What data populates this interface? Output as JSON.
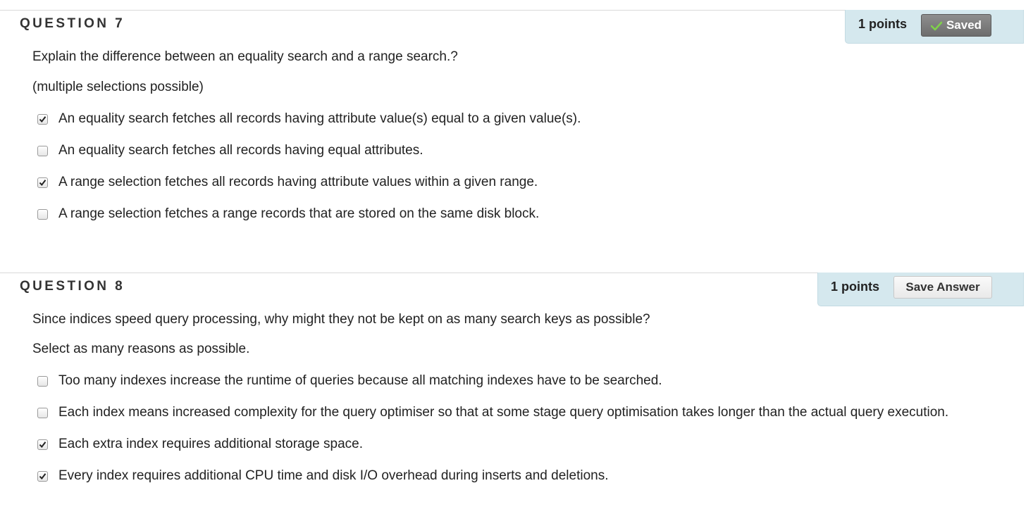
{
  "questions": [
    {
      "title": "QUESTION 7",
      "points": "1 points",
      "button_label": "Saved",
      "button_state": "saved",
      "prompt": "Explain the difference between an equality search and a range search.?",
      "instruction": "(multiple selections possible)",
      "options": [
        {
          "label": "An equality search fetches all records having attribute value(s) equal to a given value(s).",
          "checked": true
        },
        {
          "label": "An equality search fetches all records having equal attributes.",
          "checked": false
        },
        {
          "label": "A range selection fetches all records having attribute values within a given range.",
          "checked": true
        },
        {
          "label": "A range selection fetches a range records that are stored on the same disk block.",
          "checked": false
        }
      ]
    },
    {
      "title": "QUESTION 8",
      "points": "1 points",
      "button_label": "Save Answer",
      "button_state": "unsaved",
      "prompt": "Since indices speed query processing, why might they not be kept on as many search keys as possible?",
      "instruction": "Select as many reasons as possible.",
      "options": [
        {
          "label": "Too many indexes increase the runtime of queries because all matching indexes have to be searched.",
          "checked": false
        },
        {
          "label": "Each index means increased complexity for the query optimiser so that at some stage query optimisation takes longer than the actual query execution.",
          "checked": false
        },
        {
          "label": "Each extra index requires additional storage space.",
          "checked": true
        },
        {
          "label": "Every index requires additional CPU time and disk I/O overhead during inserts and deletions.",
          "checked": true
        }
      ]
    }
  ],
  "colors": {
    "points_bg": "#d5e8ee",
    "saved_button": "#7d7d7d",
    "check_green": "#5cb82e"
  },
  "icons": [
    "check-icon",
    "checkbox-checkmark-icon"
  ]
}
